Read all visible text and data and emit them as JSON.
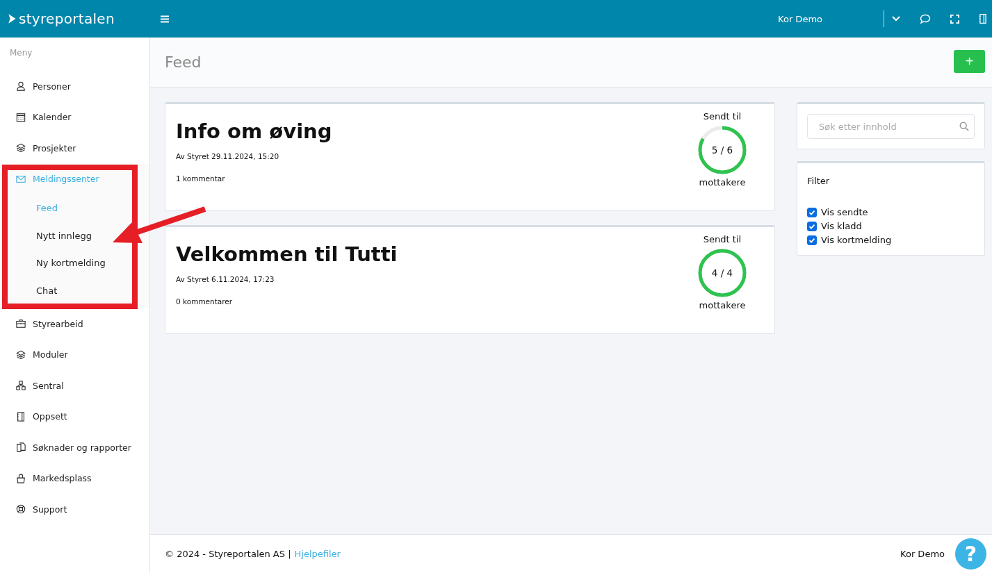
{
  "topbar": {
    "logo": "styreportalen",
    "user": "Kor Demo"
  },
  "sidebar": {
    "heading": "Meny",
    "items": [
      {
        "label": "Personer",
        "selected": false
      },
      {
        "label": "Kalender",
        "selected": false
      },
      {
        "label": "Prosjekter",
        "selected": false
      },
      {
        "label": "Meldingssenter",
        "selected": true,
        "children": [
          {
            "label": "Feed",
            "selected": true
          },
          {
            "label": "Nytt innlegg",
            "selected": false
          },
          {
            "label": "Ny kortmelding",
            "selected": false
          },
          {
            "label": "Chat",
            "selected": false
          }
        ]
      },
      {
        "label": "Styrearbeid",
        "selected": false
      },
      {
        "label": "Moduler",
        "selected": false
      },
      {
        "label": "Sentral",
        "selected": false
      },
      {
        "label": "Oppsett",
        "selected": false
      },
      {
        "label": "Søknader og rapporter",
        "selected": false
      },
      {
        "label": "Markedsplass",
        "selected": false
      },
      {
        "label": "Support",
        "selected": false
      }
    ]
  },
  "page": {
    "title": "Feed",
    "add_button": "+"
  },
  "posts": [
    {
      "title": "Info om øving",
      "meta": "Av Styret 29.11.2024, 15:20",
      "comments": "1 kommentar",
      "sent_label": "Sendt til",
      "count": "5 / 6",
      "level": 0.833,
      "recipients_label": "mottakere"
    },
    {
      "title": "Velkommen til Tutti",
      "meta": "Av Styret 6.11.2024, 17:23",
      "comments": "0 kommentarer",
      "sent_label": "Sendt til",
      "count": "4 / 4",
      "level": 1,
      "recipients_label": "mottakere"
    }
  ],
  "search": {
    "placeholder": "Søk etter innhold"
  },
  "filter": {
    "title": "Filter",
    "options": [
      {
        "label": "Vis sendte",
        "checked": true
      },
      {
        "label": "Vis kladd",
        "checked": true
      },
      {
        "label": "Vis kortmelding",
        "checked": true
      }
    ]
  },
  "footer": {
    "copyright": "© 2024 - Styreportalen AS |",
    "link": "Hjelpefiler",
    "user": "Kor Demo",
    "help_button": "?"
  }
}
